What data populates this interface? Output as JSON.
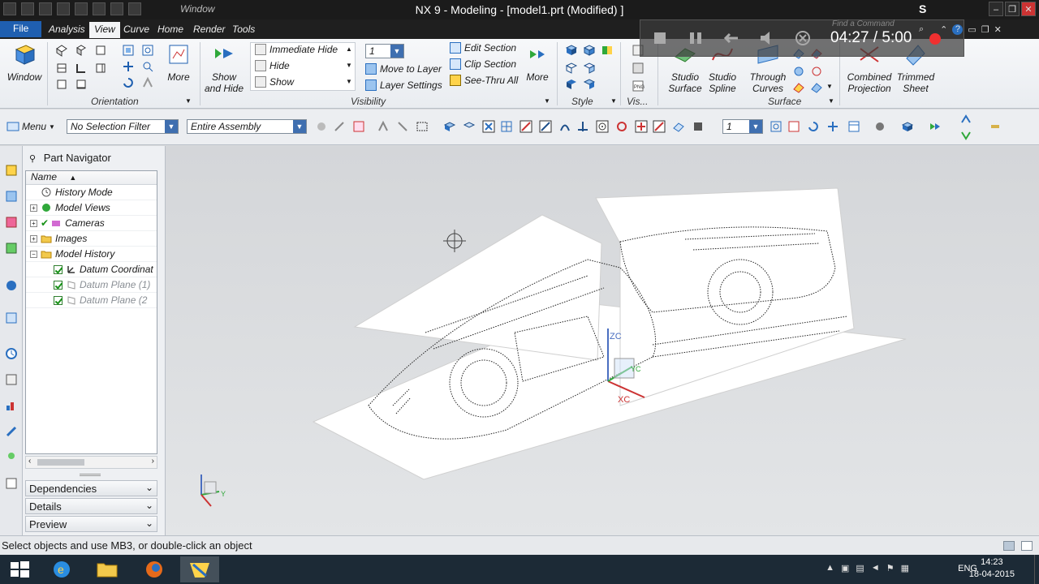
{
  "window": {
    "title": "NX 9 - Modeling - [model1.prt (Modified) ]",
    "window_menu": "Window",
    "user_initial": "S"
  },
  "tabs": {
    "file": "File",
    "items": [
      "Analysis",
      "View",
      "Curve",
      "Home",
      "Render",
      "Tools"
    ],
    "active": "View"
  },
  "ribbon": {
    "window_label": "Window",
    "more1": "More",
    "show_hide": "Show\nand Hide",
    "immediate_hide": "Immediate Hide",
    "hide": "Hide",
    "show": "Show",
    "layer_value": "1",
    "move_to_layer": "Move to Layer",
    "layer_settings": "Layer Settings",
    "edit_section": "Edit Section",
    "clip_section": "Clip Section",
    "see_thru_all": "See-Thru All",
    "more2": "More",
    "studio_surface": "Studio\nSurface",
    "studio_spline": "Studio\nSpline",
    "through_curves": "Through\nCurves",
    "combined_projection": "Combined\nProjection",
    "trimmed_sheet": "Trimmed\nSheet",
    "groups": {
      "orientation": "Orientation",
      "visibility": "Visibility",
      "style": "Style",
      "vis_short": "Vis...",
      "surface": "Surface"
    }
  },
  "selection_bar": {
    "menu": "Menu",
    "filter": "No Selection Filter",
    "scope": "Entire Assembly",
    "layer": "1"
  },
  "navigator": {
    "title": "Part Navigator",
    "column": "Name",
    "rows": [
      {
        "label": "History Mode",
        "expand": false,
        "child": false
      },
      {
        "label": "Model Views",
        "expand": true,
        "child": false
      },
      {
        "label": "Cameras",
        "expand": true,
        "child": false
      },
      {
        "label": "Images",
        "expand": true,
        "child": false
      },
      {
        "label": "Model History",
        "expand": true,
        "child": false
      },
      {
        "label": "Datum Coordinat",
        "child": true
      },
      {
        "label": "Datum Plane (1)",
        "child": true
      },
      {
        "label": "Datum Plane (2",
        "child": true
      }
    ],
    "panels": [
      "Dependencies",
      "Details",
      "Preview"
    ]
  },
  "graphics": {
    "zc_label": "ZC",
    "xc_label": "XC",
    "yc_label": "YC",
    "mini_y": "Y"
  },
  "cue_line": "Select objects and use MB3, or double-click an object",
  "recorder": {
    "time": "04:27 / 5:00",
    "search_hint": "Find a Command"
  },
  "taskbar": {
    "language": "ENG",
    "clock_time": "14:23",
    "clock_date": "18-04-2015"
  },
  "colors": {
    "title_bg": "#1b1b1b",
    "file_tab": "#1f5fb0",
    "ribbon_bg": "#eef0f3",
    "graphics_bg": "#d8dadc",
    "recorder_dot": "#f03030"
  }
}
